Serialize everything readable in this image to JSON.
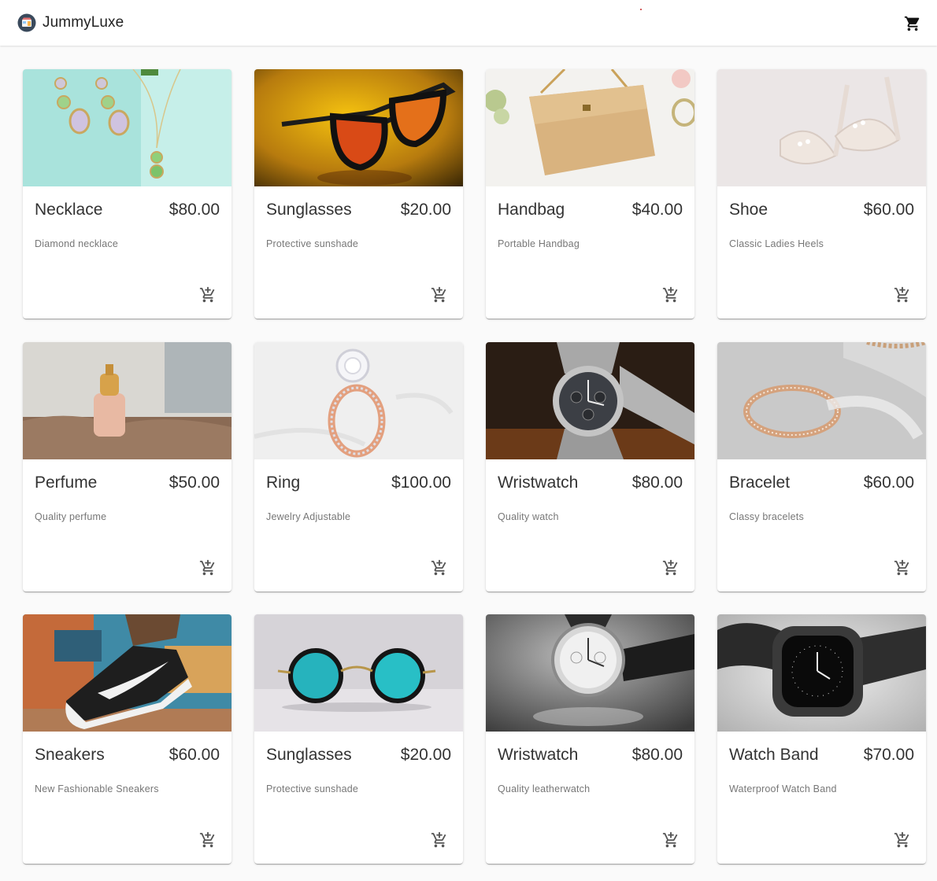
{
  "header": {
    "brand": "JummyLuxe",
    "logo_icon": "shop-icon",
    "cart_icon": "shopping-cart-icon"
  },
  "products": [
    {
      "name": "Necklace",
      "price": "$80.00",
      "description": "Diamond necklace",
      "image": "necklace-image"
    },
    {
      "name": "Sunglasses",
      "price": "$20.00",
      "description": "Protective sunshade",
      "image": "sunglasses-image"
    },
    {
      "name": "Handbag",
      "price": "$40.00",
      "description": "Portable Handbag",
      "image": "handbag-image"
    },
    {
      "name": "Shoe",
      "price": "$60.00",
      "description": "Classic Ladies Heels",
      "image": "shoe-image"
    },
    {
      "name": "Perfume",
      "price": "$50.00",
      "description": "Quality perfume",
      "image": "perfume-image"
    },
    {
      "name": "Ring",
      "price": "$100.00",
      "description": "Jewelry Adjustable",
      "image": "ring-image"
    },
    {
      "name": "Wristwatch",
      "price": "$80.00",
      "description": "Quality watch",
      "image": "wristwatch-image"
    },
    {
      "name": "Bracelet",
      "price": "$60.00",
      "description": "Classy bracelets",
      "image": "bracelet-image"
    },
    {
      "name": "Sneakers",
      "price": "$60.00",
      "description": "New Fashionable Sneakers",
      "image": "sneakers-image"
    },
    {
      "name": "Sunglasses",
      "price": "$20.00",
      "description": "Protective sunshade",
      "image": "round-sunglasses-image"
    },
    {
      "name": "Wristwatch",
      "price": "$80.00",
      "description": "Quality leatherwatch",
      "image": "leather-wristwatch-image"
    },
    {
      "name": "Watch Band",
      "price": "$70.00",
      "description": "Waterproof Watch Band",
      "image": "smartwatch-image"
    }
  ],
  "colors": {
    "background": "#fafafa",
    "card": "#ffffff",
    "text": "#333333",
    "muted": "#777777",
    "icon": "#555555"
  }
}
